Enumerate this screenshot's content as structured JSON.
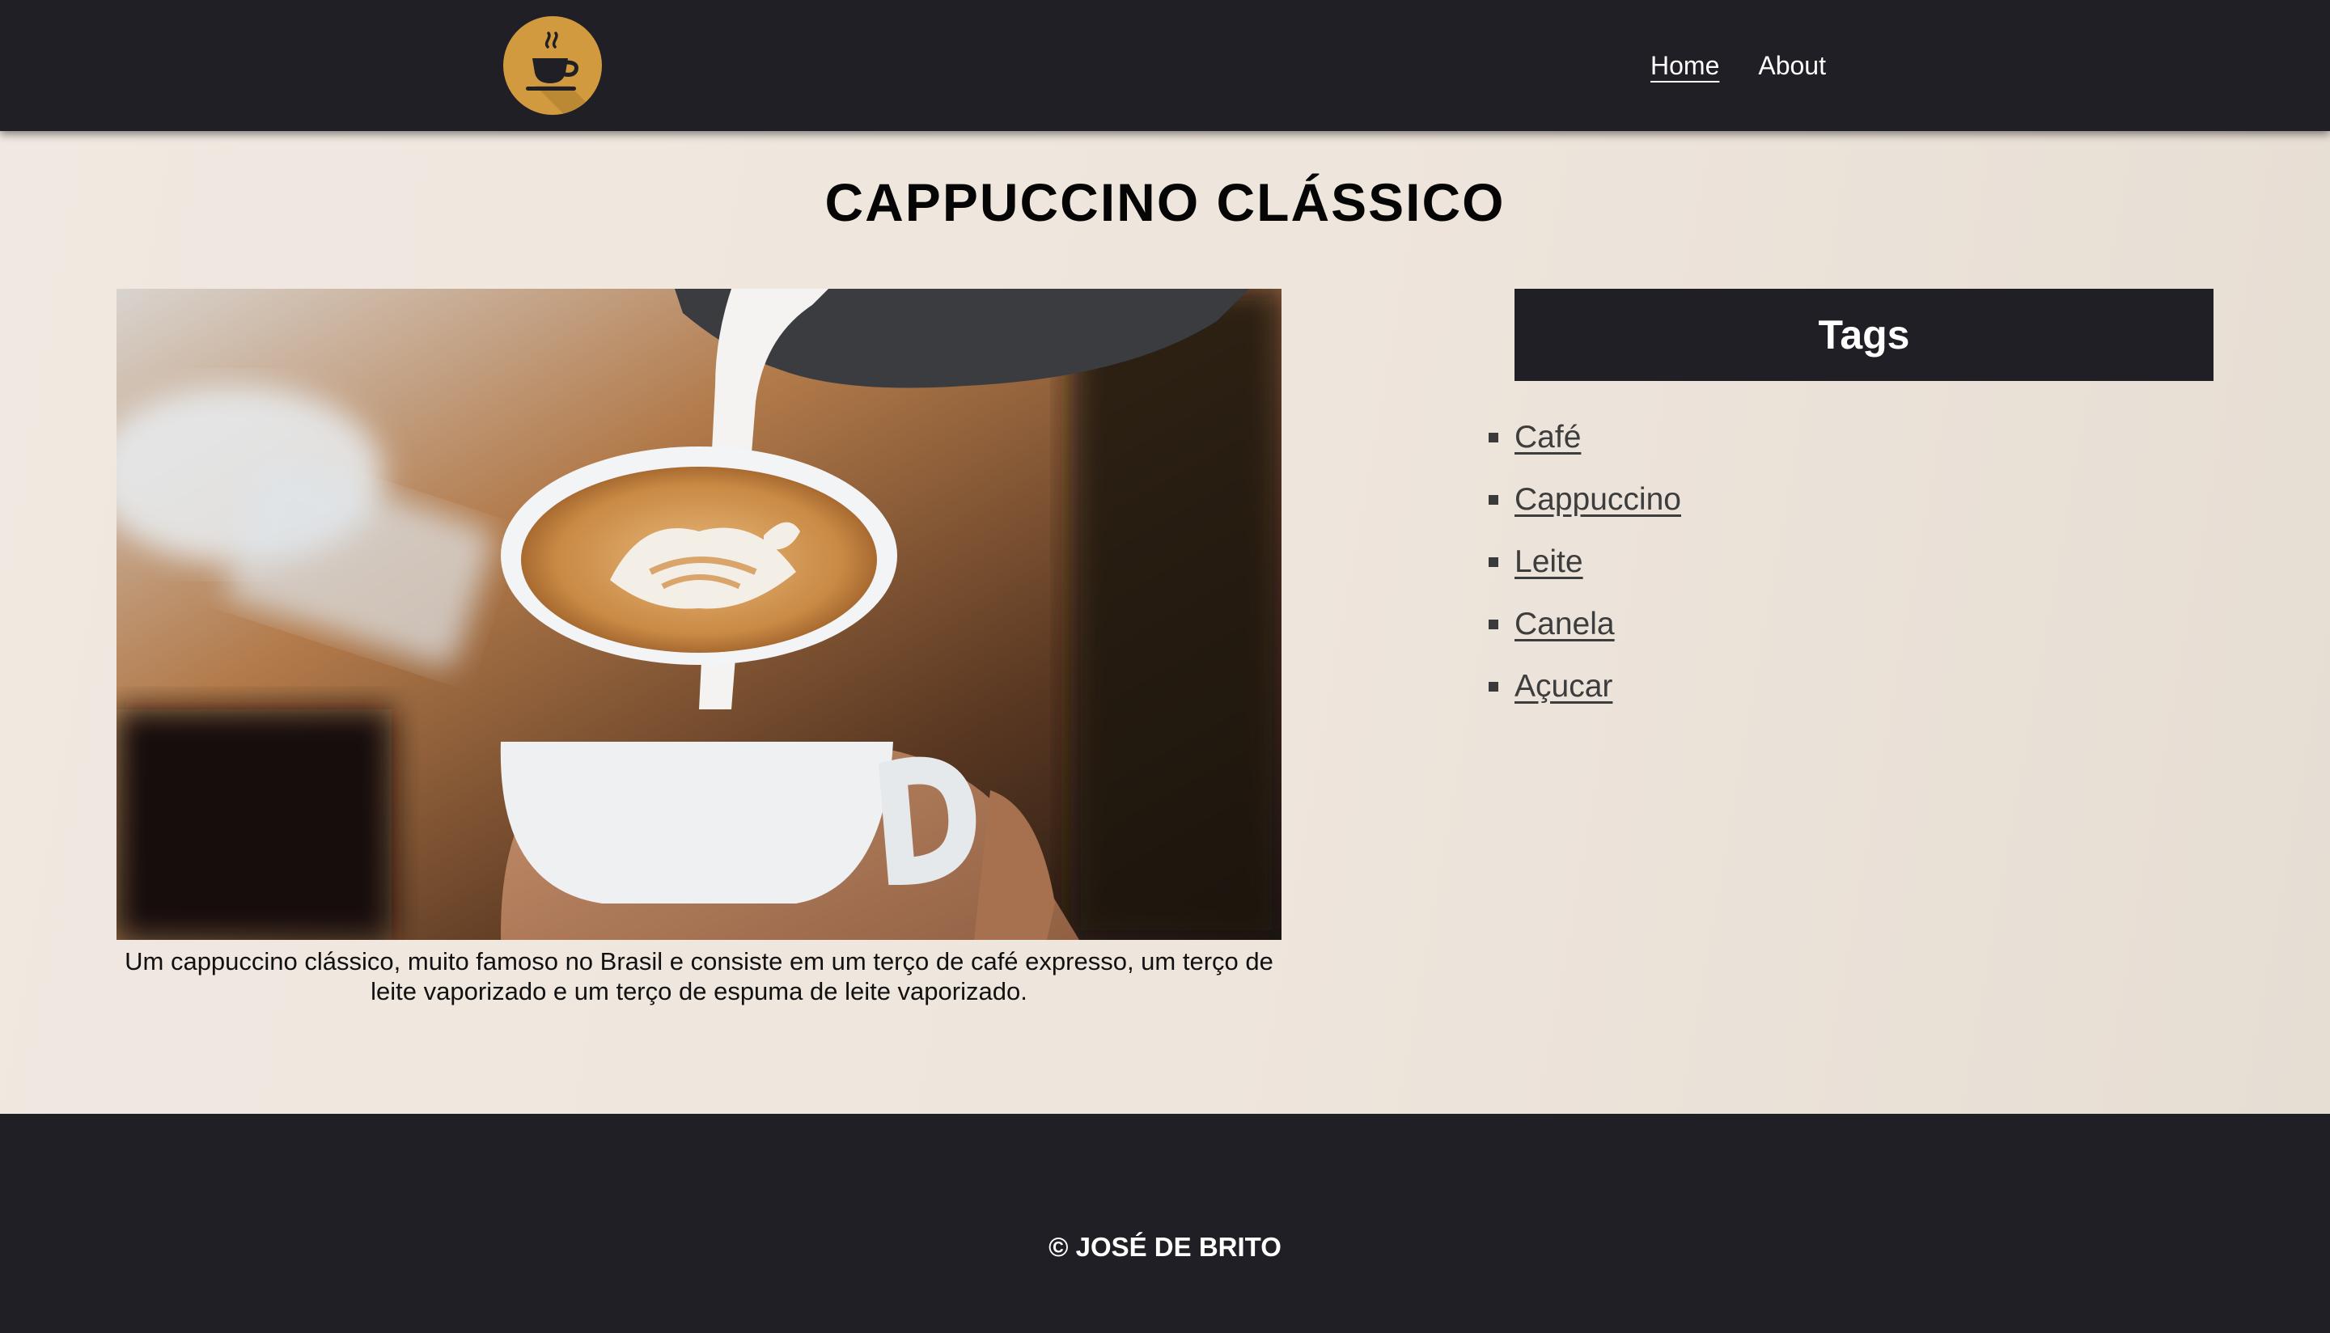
{
  "nav": {
    "logo_icon": "coffee-cup-icon",
    "links": [
      {
        "label": "Home",
        "active": true
      },
      {
        "label": "About",
        "active": false
      }
    ]
  },
  "page": {
    "title": "CAPPUCCINO CLÁSSICO",
    "image_icon": "cappuccino-photo",
    "caption": "Um cappuccino clássico, muito famoso no Brasil e consiste em um terço de café expresso, um terço de leite vaporizado e um terço de espuma de leite vaporizado."
  },
  "tags": {
    "heading": "Tags",
    "items": [
      "Café",
      "Cappuccino",
      "Leite",
      "Canela",
      "Açucar"
    ]
  },
  "footer": {
    "text": "© JOSÉ DE BRITO"
  },
  "colors": {
    "dark": "#1f1f25",
    "accent": "#d19a3f",
    "background": "#f0e8e0"
  }
}
